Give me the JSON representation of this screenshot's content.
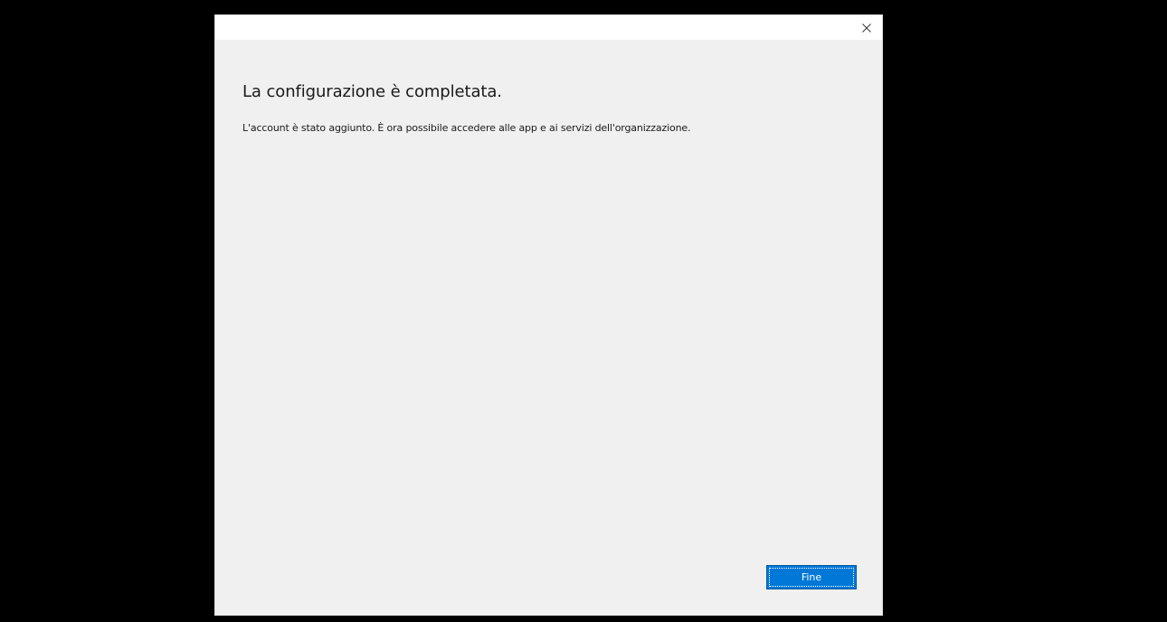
{
  "dialog": {
    "heading": "La configurazione è completata.",
    "message": "L'account è stato aggiunto. È ora possibile accedere alle app e ai servizi dell'organizzazione.",
    "finish_label": "Fine",
    "close_icon": "close-icon"
  },
  "colors": {
    "background": "#000000",
    "dialog_bg": "#f0f0f0",
    "titlebar_bg": "#ffffff",
    "accent": "#0078d7",
    "text": "#1a1a1a"
  }
}
